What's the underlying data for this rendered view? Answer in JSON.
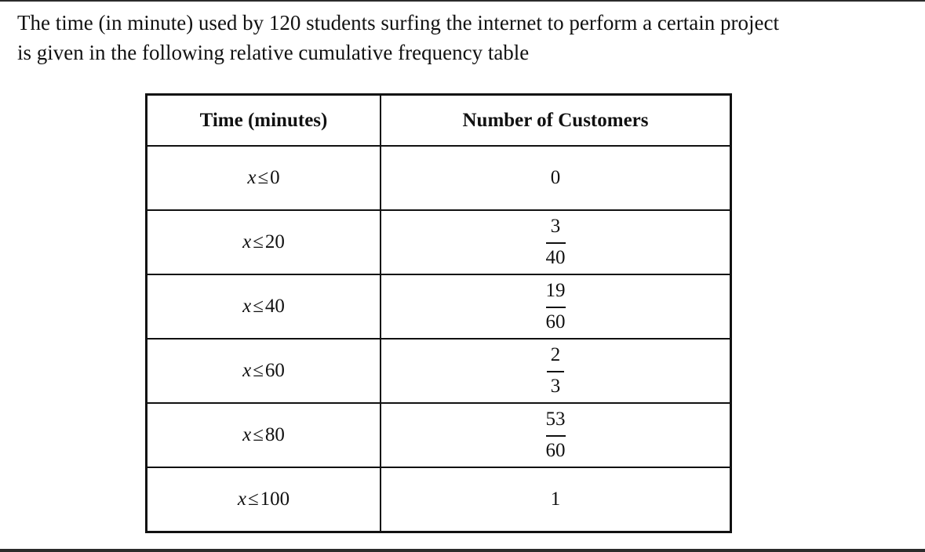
{
  "question": {
    "line1": "The time (in minute) used by 120 students surfing the internet to perform a certain project",
    "line2": "is given in the following relative cumulative frequency table"
  },
  "table": {
    "headers": [
      "Time (minutes)",
      "Number of Customers"
    ],
    "rows": [
      {
        "variable": "x",
        "operator": "≤",
        "bound": "0",
        "value": {
          "type": "whole",
          "text": "0"
        }
      },
      {
        "variable": "x",
        "operator": "≤",
        "bound": "20",
        "value": {
          "type": "fraction",
          "numerator": "3",
          "denominator": "40"
        }
      },
      {
        "variable": "x",
        "operator": "≤",
        "bound": "40",
        "value": {
          "type": "fraction",
          "numerator": "19",
          "denominator": "60"
        }
      },
      {
        "variable": "x",
        "operator": "≤",
        "bound": "60",
        "value": {
          "type": "fraction",
          "numerator": "2",
          "denominator": "3"
        }
      },
      {
        "variable": "x",
        "operator": "≤",
        "bound": "80",
        "value": {
          "type": "fraction",
          "numerator": "53",
          "denominator": "60"
        }
      },
      {
        "variable": "x",
        "operator": "≤",
        "bound": "100",
        "value": {
          "type": "whole",
          "text": "1"
        }
      }
    ]
  }
}
